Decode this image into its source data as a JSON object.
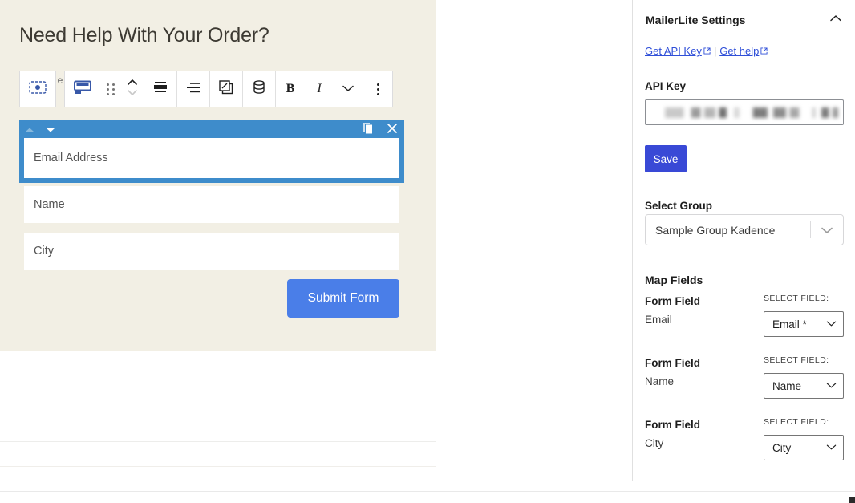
{
  "editor": {
    "section_heading": "Need Help With Your Order?",
    "ghost_letter": "e",
    "toolbar": {
      "select_block_icon": "block-select-icon",
      "block_type_icon": "form-field-block-icon",
      "drag_icon": "drag-handle-icon",
      "move_icon": "move-up-down-icon",
      "align_icon": "align-icon",
      "justify_icon": "text-align-icon",
      "edit_icon": "edit-duplicate-icon",
      "database_icon": "database-icon",
      "bold_label": "B",
      "italic_label": "I",
      "chevron_icon": "chevron-down-icon",
      "more_icon": "more-options-icon"
    },
    "email_block": {
      "move_up_icon": "move-up-icon",
      "move_down_icon": "move-down-icon",
      "duplicate_icon": "duplicate-icon",
      "close_icon": "close-icon",
      "placeholder": "Email Address"
    },
    "fields": [
      {
        "placeholder": "Name"
      },
      {
        "placeholder": "City"
      }
    ],
    "submit_label": "Submit Form"
  },
  "sidebar": {
    "panel_title": "MailerLite Settings",
    "collapse_icon": "chevron-up-icon",
    "links": {
      "api_key_link": "Get API Key",
      "separator": "|",
      "help_link": "Get help",
      "external_icon": "external-link-icon"
    },
    "api_key": {
      "label": "API Key",
      "value": "",
      "masked": true
    },
    "save_label": "Save",
    "select_group": {
      "label": "Select Group",
      "value": "Sample Group Kadence",
      "chevron_icon": "chevron-down-icon"
    },
    "map_fields": {
      "label": "Map Fields",
      "rows": [
        {
          "header": "Form Field",
          "field": "Email",
          "select_label": "SELECT FIELD:",
          "selected": "Email *"
        },
        {
          "header": "Form Field",
          "field": "Name",
          "select_label": "SELECT FIELD:",
          "selected": "Name"
        },
        {
          "header": "Form Field",
          "field": "City",
          "select_label": "SELECT FIELD:",
          "selected": "City"
        }
      ]
    }
  },
  "colors": {
    "canvas_bg": "#f2efe4",
    "block_selected": "#3e8ccb",
    "submit_blue": "#4a7ee8",
    "save_blue": "#3949d6",
    "link_blue": "#2f4fd8"
  }
}
